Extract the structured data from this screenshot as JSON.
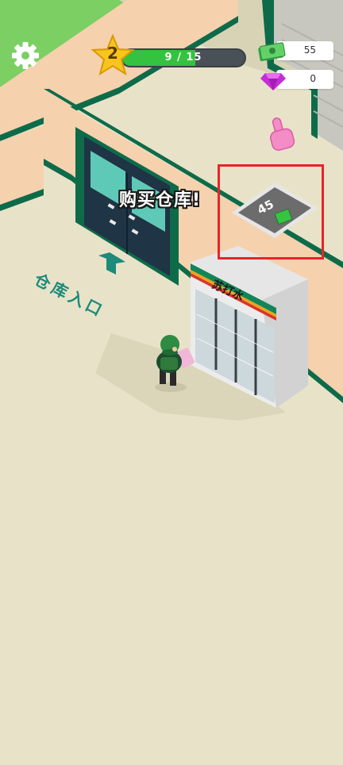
{
  "hud": {
    "level": "2",
    "xp": {
      "text": "9 / 15",
      "current": 9,
      "max": 15
    },
    "cash": "55",
    "gems": "0"
  },
  "scene": {
    "prompt": "购买仓库!",
    "purchase_price": "45",
    "entrance_label": "仓库入口",
    "fridge_sign": "苏打水"
  },
  "colors": {
    "floor": "#e8e3c8",
    "wall": "#f6d1ae",
    "trim": "#0e6b4a",
    "door": "#1f3445",
    "grass": "#7ccf63",
    "xp_fill": "#35c240",
    "highlight": "#e8242a"
  },
  "icons": [
    "gear-icon",
    "star-icon",
    "cash-icon",
    "gem-icon",
    "pointer-hand-icon",
    "money-icon",
    "arrow-up-icon"
  ]
}
